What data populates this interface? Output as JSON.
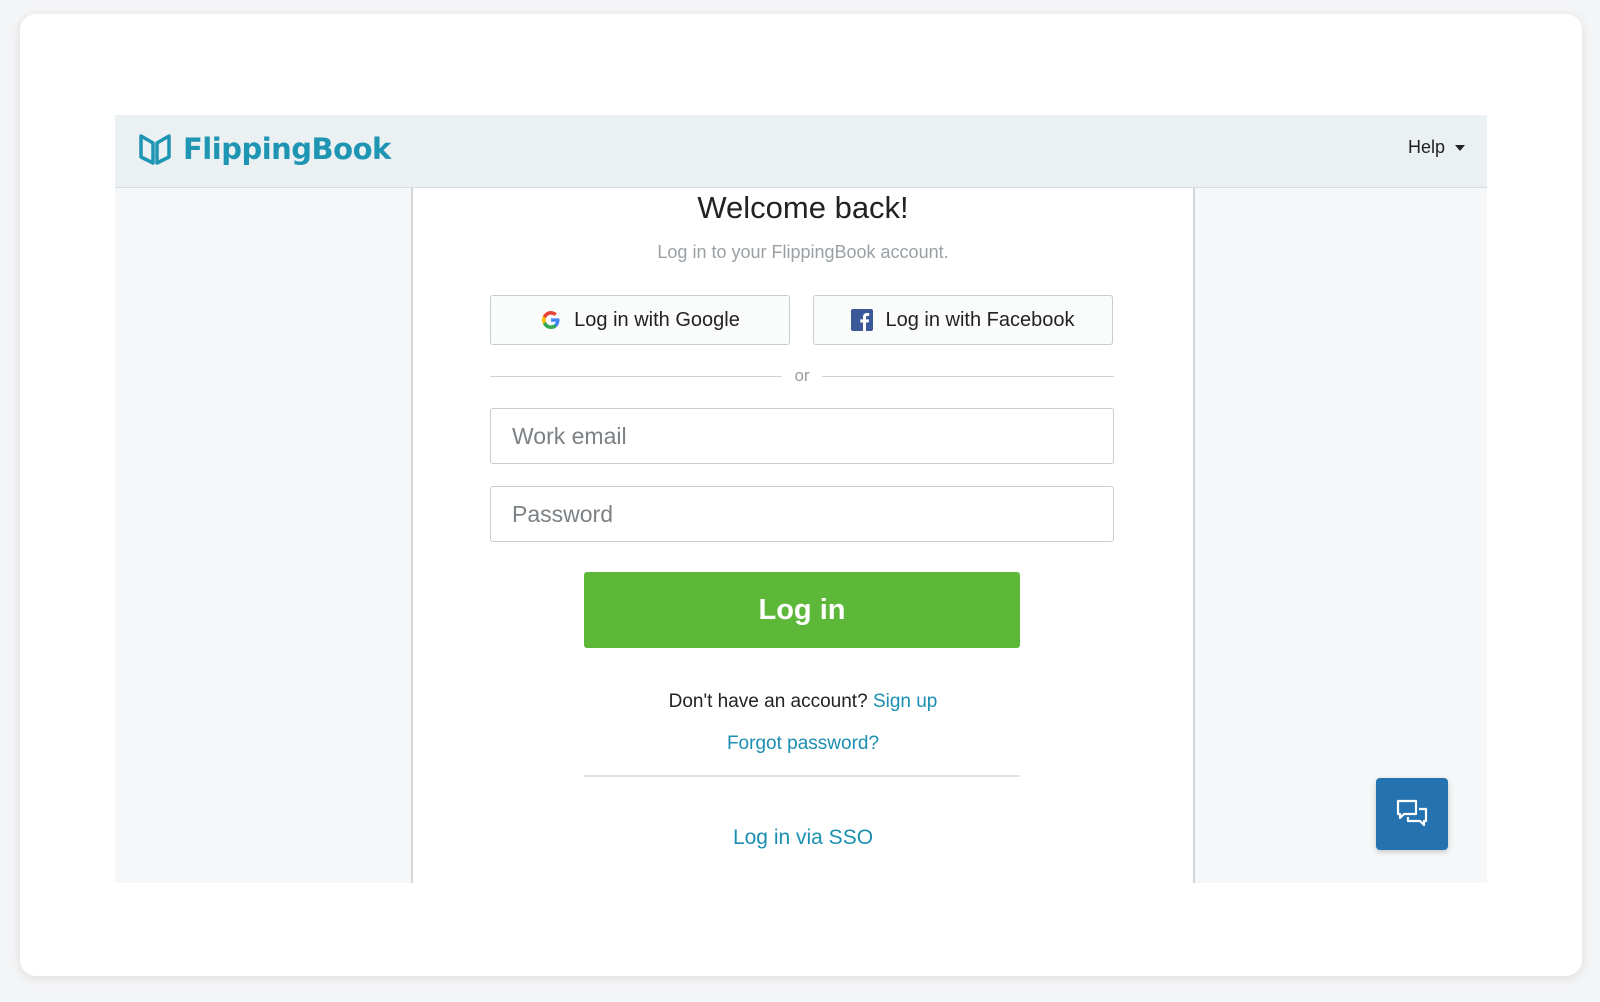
{
  "header": {
    "logo_text": "FlippingBook",
    "help_label": "Help"
  },
  "login": {
    "title": "Welcome back!",
    "subtitle": "Log in to your FlippingBook account.",
    "google_label": "Log in with Google",
    "facebook_label": "Log in with Facebook",
    "or_label": "or",
    "email_placeholder": "Work email",
    "email_value": "",
    "password_placeholder": "Password",
    "password_value": "",
    "login_label": "Log in",
    "no_account_text": "Don't have an account?",
    "signup_label": "Sign up",
    "forgot_label": "Forgot password?",
    "sso_label": "Log in via SSO"
  },
  "icons": {
    "logo": "flippingbook-logo-icon",
    "google": "google-icon",
    "facebook": "facebook-icon",
    "help_caret": "caret-down-icon",
    "chat": "chat-icon"
  },
  "colors": {
    "brand": "#1e95b3",
    "login_button": "#5db83a",
    "link": "#1b8fb1",
    "chat_button": "#2473b0",
    "header_bg": "#ebf0f2"
  }
}
